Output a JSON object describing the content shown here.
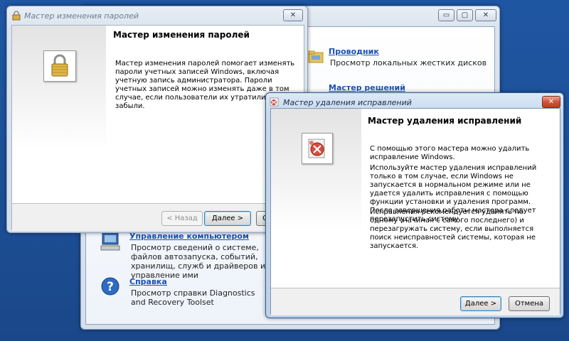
{
  "control_panel": {
    "items": [
      {
        "title": "Проводник",
        "desc": "Просмотр локальных жестких дисков"
      },
      {
        "title": "Мастер решений",
        "desc": ""
      },
      {
        "title": "Управление компьютером",
        "desc": "Просмотр сведений о системе, файлов автозапуска, событий, хранилищ, служб и драйверов и управление ими"
      },
      {
        "title": "Справка",
        "desc": "Просмотр справки Diagnostics and Recovery Toolset"
      }
    ]
  },
  "password_wizard": {
    "window_title": "Мастер изменения паролей",
    "heading": "Мастер изменения паролей",
    "body": "Мастер изменения паролей помогает изменять пароли учетных записей Windows, включая учетную запись администратора. Пароли учетных записей можно изменять даже в том случае, если пользователи их утратили или забыли.",
    "back_label": "< Назад",
    "next_label": "Далее >",
    "cancel_label": "От"
  },
  "hotfix_wizard": {
    "window_title": "Мастер удаления исправлений",
    "heading": "Мастер удаления исправлений",
    "p1": "С помощью этого мастера можно удалить исправление Windows.",
    "p2": "Используйте мастер удаления исправлений только в том случае, если Windows не запускается в нормальном режиме или не удается удалить исправления с помощью функции установки и удаления программ. После завершения работы мастера следует перезапустить систему.",
    "p3": "Исправления рекомендуется удалять по одному (начиная с самого последнего) и перезагружать систему, если выполняется поиск неисправностей системы, которая не запускается.",
    "next_label": "Далее >",
    "cancel_label": "Отмена"
  },
  "caption_buttons": {
    "minimize": "▭",
    "maximize": "▢",
    "close": "✕"
  }
}
